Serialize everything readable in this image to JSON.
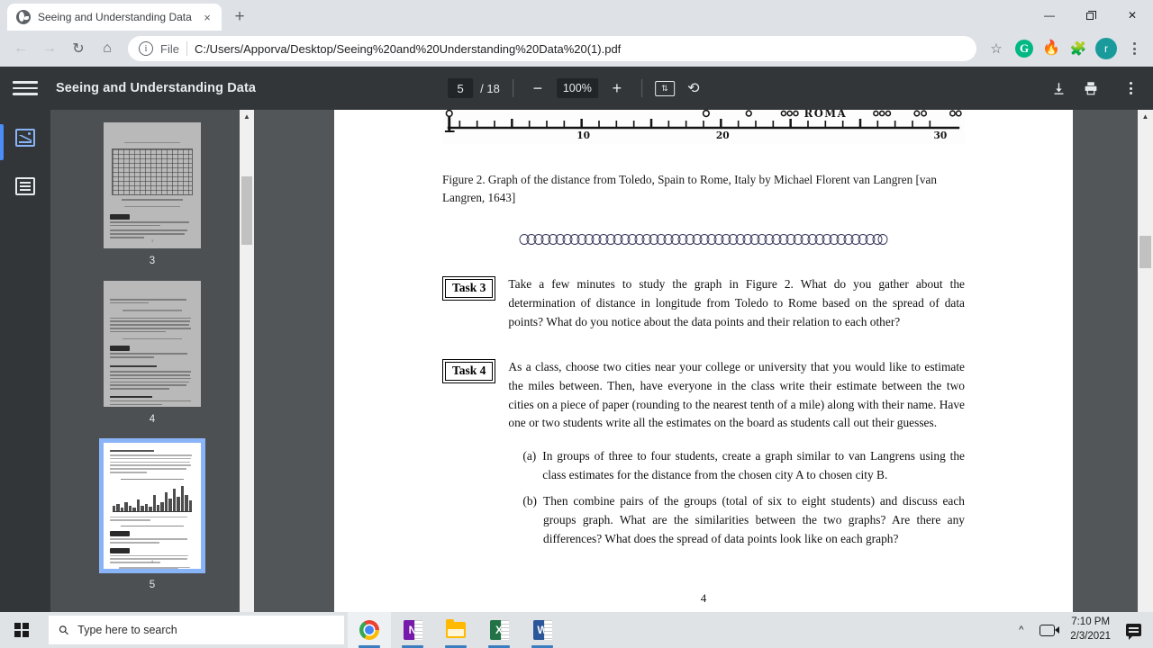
{
  "browser": {
    "tab": {
      "title": "Seeing and Understanding Data",
      "favicon": "globe-icon",
      "close": "×"
    },
    "newtab_label": "+",
    "window_controls": {
      "minimize": "—",
      "restore": "restore-icon",
      "close": "✕"
    },
    "nav": {
      "back": "←",
      "forward": "→",
      "reload": "↻",
      "home": "⌂"
    },
    "omnibox": {
      "info_icon": "i",
      "scheme_label": "File",
      "url": "C:/Users/Apporva/Desktop/Seeing%20and%20Understanding%20Data%20(1).pdf"
    },
    "bookmark_star": "☆",
    "extensions": [
      {
        "name": "grammarly-extension-icon",
        "glyph": "G"
      },
      {
        "name": "flame-extension-icon",
        "glyph": "🔥"
      },
      {
        "name": "extensions-puzzle-icon",
        "glyph": "🧩"
      }
    ],
    "profile_avatar": "r",
    "menu_icon": "kebab-menu-icon"
  },
  "pdf_toolbar": {
    "menu_icon": "hamburger-icon",
    "title": "Seeing and Understanding Data",
    "current_page": "5",
    "page_total": "/ 18",
    "zoom_out": "−",
    "zoom_level": "100%",
    "zoom_in": "+",
    "fit_icon": "fit-to-page-icon",
    "rotate_icon": "rotate-icon",
    "download_icon": "⬇",
    "print_icon": "printer-icon",
    "more_icon": "kebab-menu-icon"
  },
  "sidebar": {
    "rail": [
      {
        "name": "thumbnails-view-icon",
        "active": true
      },
      {
        "name": "document-outline-icon",
        "active": false
      }
    ],
    "thumbnails": [
      {
        "label": "3",
        "selected": false
      },
      {
        "label": "4",
        "selected": false
      },
      {
        "label": "5",
        "selected": true
      }
    ]
  },
  "document": {
    "figure": {
      "alt": "historical-ruler-graph",
      "axis_labels": [
        "10",
        "20",
        "30"
      ],
      "city_label": "ROMA"
    },
    "figure_caption": "Figure 2. Graph of the distance from Toledo, Spain to Rome, Italy by Michael Florent van Langren [van Langren, 1643]",
    "ornament": "decorative-chain-divider",
    "tasks": [
      {
        "label": "Task 3",
        "text": "Take a few minutes to study the graph in Figure 2. What do you gather about the determination of distance in longitude from Toledo to Rome based on the spread of data points? What do you notice about the data points and their relation to each other?",
        "subitems": []
      },
      {
        "label": "Task 4",
        "text": "As a class, choose two cities near your college or university that you would like to estimate the miles between. Then, have everyone in the class write their estimate between the two cities on a piece of paper (rounding to the nearest tenth of a mile) along with their name. Have one or two students write all the estimates on the board as students call out their guesses.",
        "subitems": [
          {
            "label": "(a)",
            "text": "In groups of three to four students, create a graph similar to van Langrens using the class estimates for the distance from the chosen city A to chosen city B."
          },
          {
            "label": "(b)",
            "text": "Then combine pairs of the groups (total of six to eight students) and discuss each groups graph. What are the similarities between the two graphs? Are there any differences? What does the spread of data points look like on each graph?"
          }
        ]
      }
    ],
    "page_number": "4"
  },
  "taskbar": {
    "start_icon": "windows-logo-icon",
    "search_placeholder": "Type here to search",
    "search_icon": "search-icon",
    "apps": [
      {
        "name": "chrome-taskbar-icon",
        "active": true
      },
      {
        "name": "onenote-taskbar-icon",
        "glyph": "N"
      },
      {
        "name": "file-explorer-taskbar-icon"
      },
      {
        "name": "excel-taskbar-icon",
        "glyph": "X"
      },
      {
        "name": "word-taskbar-icon",
        "glyph": "W"
      }
    ],
    "tray": {
      "show_hidden_icon": "chevron-up-icon",
      "meet_icon": "camera-icon",
      "time": "7:10 PM",
      "date": "2/3/2021",
      "notification_icon": "notification-icon"
    }
  },
  "colors": {
    "chrome_toolbar": "#dee1e6",
    "pdf_toolbar": "#323639",
    "pdf_bg": "#525659",
    "accent_blue": "#8ab4f8",
    "avatar_teal": "#1a9b9b"
  }
}
